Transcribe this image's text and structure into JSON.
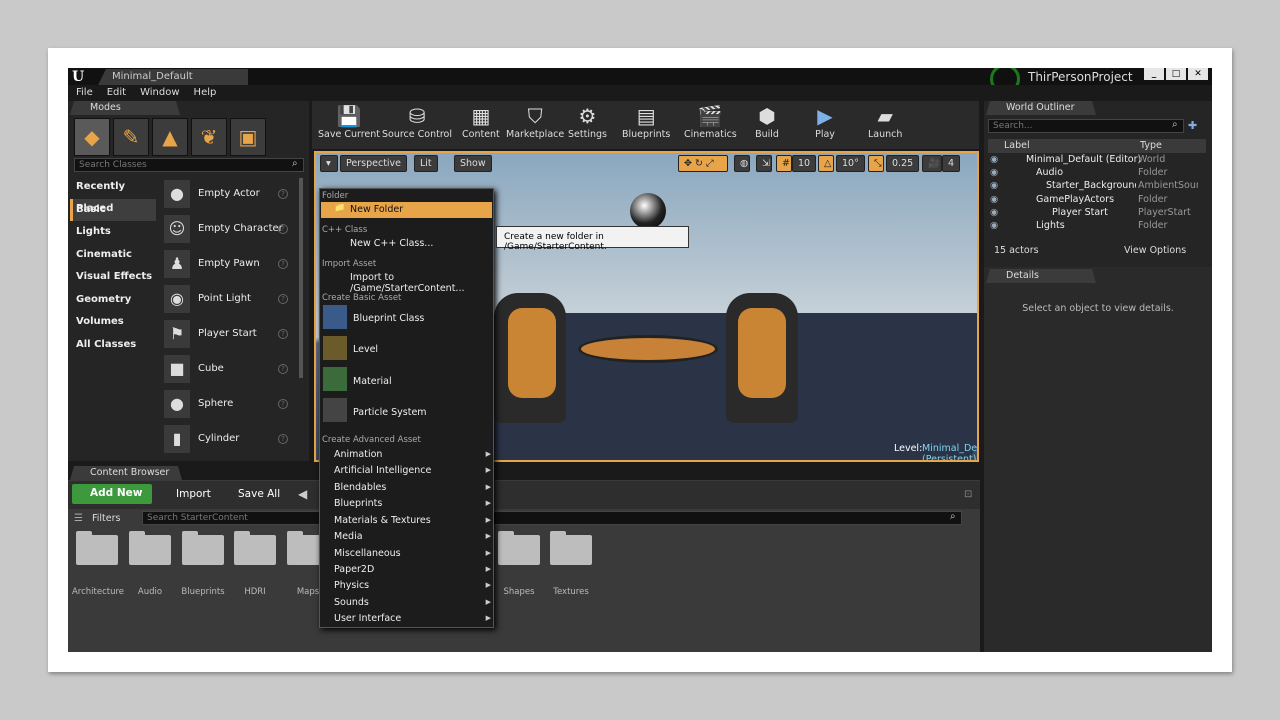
{
  "window": {
    "tab": "Minimal_Default",
    "project": "ThirPersonProject",
    "buttons": [
      "_",
      "□",
      "✕"
    ]
  },
  "menu": [
    "File",
    "Edit",
    "Window",
    "Help"
  ],
  "modes": {
    "title": "Modes",
    "search_placeholder": "Search Classes",
    "categories": [
      "Recently Placed",
      "Basic",
      "Lights",
      "Cinematic",
      "Visual Effects",
      "Geometry",
      "Volumes",
      "All Classes"
    ],
    "actors": [
      "Empty Actor",
      "Empty Character",
      "Empty Pawn",
      "Point Light",
      "Player Start",
      "Cube",
      "Sphere",
      "Cylinder"
    ]
  },
  "toolbar": [
    "Save Current",
    "Source Control",
    "Content",
    "Marketplace",
    "Settings",
    "Blueprints",
    "Cinematics",
    "Build",
    "Play",
    "Launch"
  ],
  "viewport": {
    "perspective": "Perspective",
    "lit": "Lit",
    "show": "Show",
    "grid": "10",
    "angle": "10°",
    "scale": "0.25",
    "speed": "4",
    "level_label": "Level:",
    "level_name": "Minimal_Default (Persistent)"
  },
  "outliner": {
    "title": "World Outliner",
    "search_placeholder": "Search...",
    "col_label": "Label",
    "col_type": "Type",
    "rows": [
      {
        "label": "Minimal_Default (Editor)",
        "type": "World"
      },
      {
        "label": "Audio",
        "type": "Folder"
      },
      {
        "label": "Starter_Background_C",
        "type": "AmbientSoun"
      },
      {
        "label": "GamePlayActors",
        "type": "Folder"
      },
      {
        "label": "Player Start",
        "type": "PlayerStart"
      },
      {
        "label": "Lights",
        "type": "Folder"
      }
    ],
    "count": "15 actors",
    "view_options": "View Options"
  },
  "details": {
    "title": "Details",
    "empty": "Select an object to view details."
  },
  "content_browser": {
    "title": "Content Browser",
    "add_new": "Add New",
    "import": "Import",
    "save_all": "Save All",
    "filters": "Filters",
    "search_placeholder": "Search StarterContent",
    "folders": [
      "Architecture",
      "Audio",
      "Blueprints",
      "HDRI",
      "Maps",
      "Shapes",
      "Textures"
    ]
  },
  "context_menu": {
    "sec_folder": "Folder",
    "new_folder": "New Folder",
    "sec_cpp": "C++ Class",
    "new_cpp": "New C++ Class...",
    "sec_import": "Import Asset",
    "import_to": "Import to /Game/StarterContent...",
    "sec_basic": "Create Basic Asset",
    "basic": [
      "Blueprint Class",
      "Level",
      "Material",
      "Particle System"
    ],
    "sec_adv": "Create Advanced Asset",
    "advanced": [
      "Animation",
      "Artificial Intelligence",
      "Blendables",
      "Blueprints",
      "Materials & Textures",
      "Media",
      "Miscellaneous",
      "Paper2D",
      "Physics",
      "Sounds",
      "User Interface"
    ]
  },
  "tooltip": "Create a new folder in /Game/StarterContent.",
  "colors": {
    "accent": "#e8a448",
    "green": "#3c9a3c"
  }
}
